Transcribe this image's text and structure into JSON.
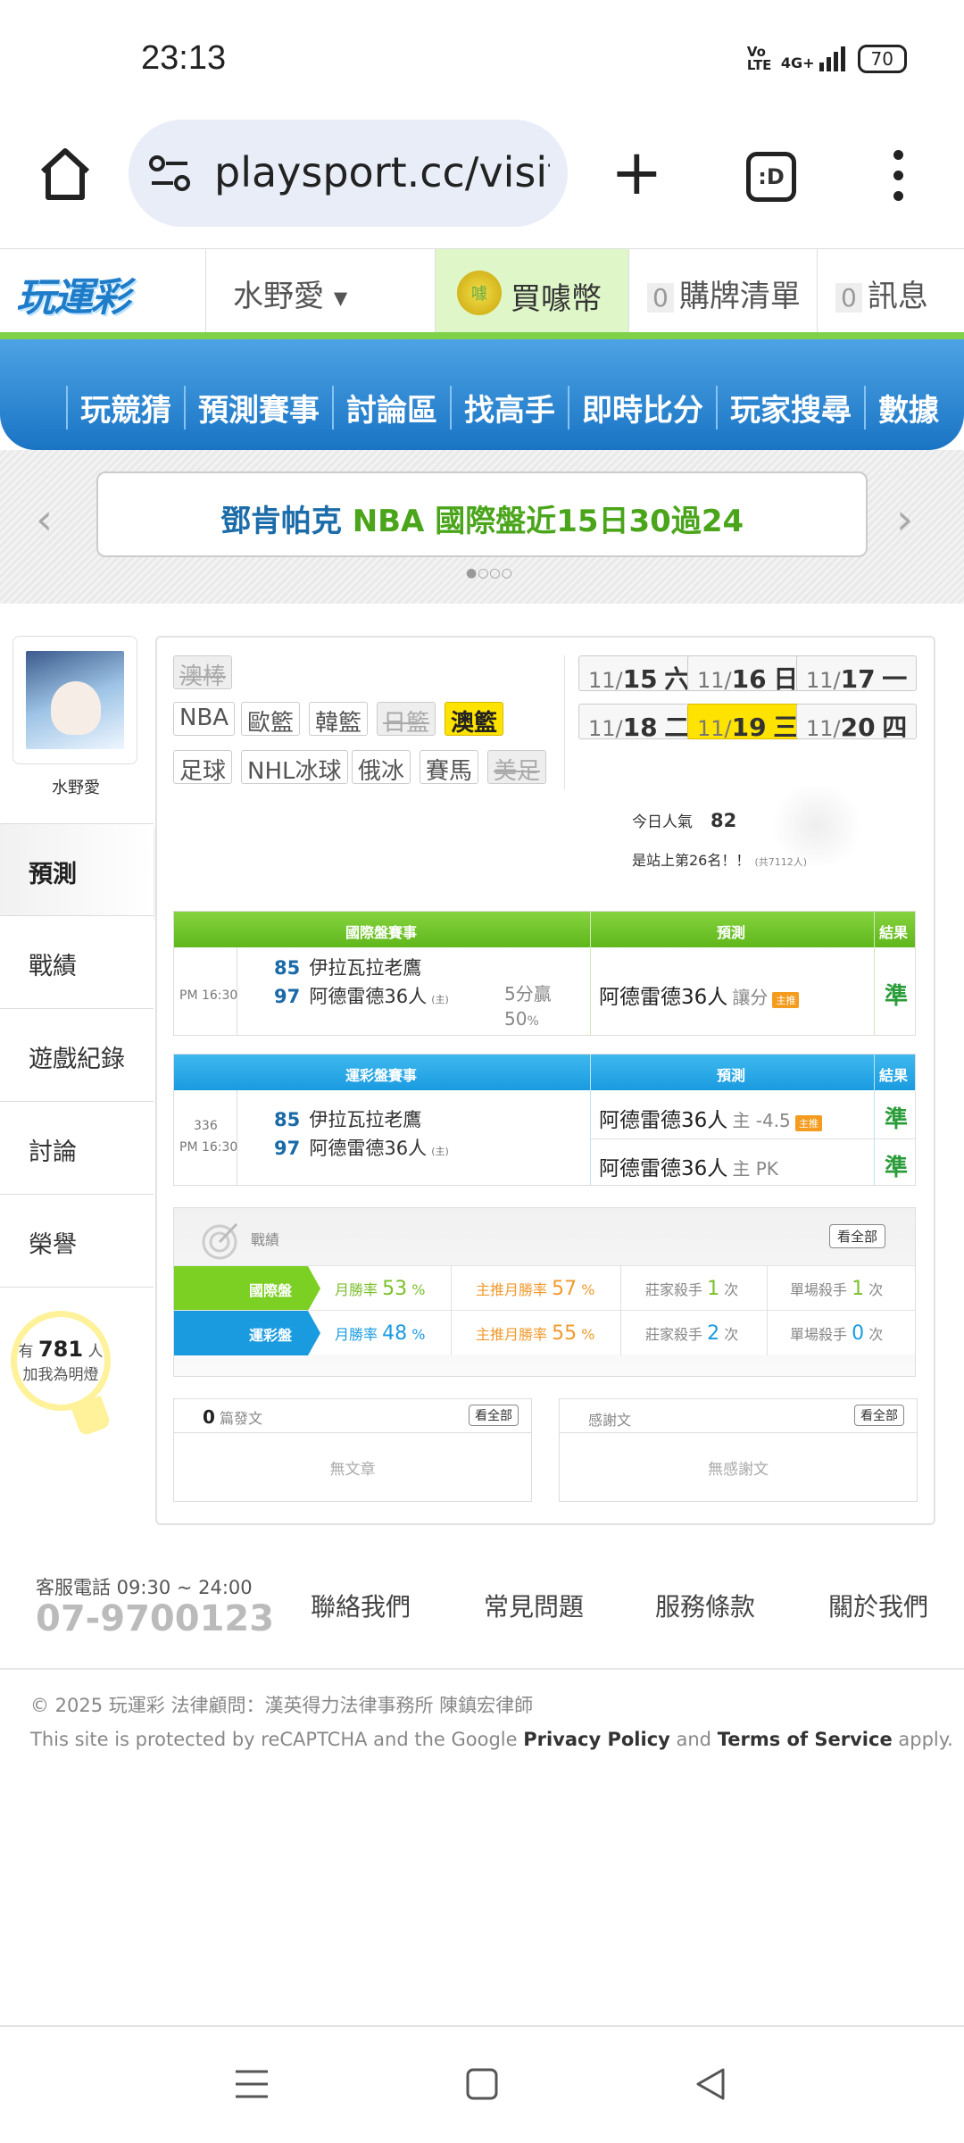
{
  "status_bar": {
    "time": "23:13",
    "volte": "Vo LTE",
    "signal": "4G+",
    "battery": "70"
  },
  "browser": {
    "url": "playsport.cc/visit",
    "tab_label": ":D"
  },
  "site_header": {
    "logo": "玩運彩",
    "user_menu": "水野愛",
    "buy_coin": "買噱幣",
    "coin_glyph": "噱",
    "cart_count": "0",
    "cart_label": "購牌清單",
    "msg_count": "0",
    "msg_label": "訊息"
  },
  "nav": [
    "玩競猜",
    "預測賽事",
    "討論區",
    "找高手",
    "即時比分",
    "玩家搜尋",
    "數據"
  ],
  "banner": {
    "part1": "鄧肯帕克 ",
    "part2": "NBA 國際盤近15日30過24",
    "prev": "‹",
    "next": "›",
    "dots": "●○○○"
  },
  "sidebar": {
    "username": "水野愛",
    "items": [
      "預測",
      "戰績",
      "遊戲紀錄",
      "討論",
      "榮譽"
    ],
    "fans_prefix": "有",
    "fans_count": "781",
    "fans_unit": "人",
    "fans_caption": "加我為明燈"
  },
  "sports_tags": {
    "row1": [
      "澳棒"
    ],
    "row2": [
      "NBA",
      "歐籃",
      "韓籃",
      "日籃",
      "澳籃"
    ],
    "row3": [
      "足球",
      "NHL冰球",
      "俄冰",
      "賽馬",
      "美足"
    ],
    "selected": "澳籃"
  },
  "dates": [
    {
      "md": "11/",
      "day": "15",
      "wk": "六"
    },
    {
      "md": "11/",
      "day": "16",
      "wk": "日"
    },
    {
      "md": "11/",
      "day": "17",
      "wk": "一"
    },
    {
      "md": "11/",
      "day": "18",
      "wk": "二"
    },
    {
      "md": "11/",
      "day": "19",
      "wk": "三"
    },
    {
      "md": "11/",
      "day": "20",
      "wk": "四"
    }
  ],
  "popularity": {
    "label": "今日人氣",
    "value": "82",
    "rank_text": "是站上第26名！！",
    "rank_total": "(共7112人)"
  },
  "intl_table": {
    "headers": [
      "國際盤賽事",
      "預測",
      "結果"
    ],
    "time": "PM 16:30",
    "away_score": "85",
    "away_team": "伊拉瓦拉老鷹",
    "home_score": "97",
    "home_team": "阿德雷德36人",
    "home_mark": "(主)",
    "margin": "5分贏",
    "pct": "50",
    "pct_sign": "%",
    "prediction": "阿德雷德36人",
    "pick": "讓分",
    "badge": "主推",
    "result": "準"
  },
  "lottery_table": {
    "headers": [
      "運彩盤賽事",
      "預測",
      "結果"
    ],
    "code": "336",
    "time": "PM 16:30",
    "away_score": "85",
    "away_team": "伊拉瓦拉老鷹",
    "home_score": "97",
    "home_team": "阿德雷德36人",
    "home_mark": "(主)",
    "pred1": "阿德雷德36人",
    "pred1_sub": "主 -4.5",
    "badge": "主推",
    "result1": "準",
    "pred2": "阿德雷德36人",
    "pred2_sub": "主 PK",
    "result2": "準"
  },
  "record": {
    "title": "戰績",
    "more": "看全部",
    "rows": [
      {
        "label": "國際盤",
        "monthly_label": "月勝率",
        "monthly": "53",
        "main_label": "主推月勝率",
        "main": "57",
        "pct": "%",
        "killer_label": "莊家殺手",
        "killer": "1",
        "single_label": "單場殺手",
        "single": "1",
        "unit": "次"
      },
      {
        "label": "運彩盤",
        "monthly_label": "月勝率",
        "monthly": "48",
        "main_label": "主推月勝率",
        "main": "55",
        "pct": "%",
        "killer_label": "莊家殺手",
        "killer": "2",
        "single_label": "單場殺手",
        "single": "0",
        "unit": "次"
      }
    ]
  },
  "articles": {
    "count": "0",
    "label": "篇發文",
    "more": "看全部",
    "empty": "無文章"
  },
  "thanks": {
    "label": "感謝文",
    "more": "看全部",
    "empty": "無感謝文"
  },
  "footer": {
    "service_label": "客服電話 09:30 ~ 24:00",
    "phone": "07-9700123",
    "links": [
      "聯絡我們",
      "常見問題",
      "服務條款",
      "關於我們"
    ],
    "copyright": "© 2025 玩運彩 法律顧問：漢英得力法律事務所 陳鎮宏律師",
    "recaptcha_pre": "This site is protected by reCAPTCHA and the Google ",
    "privacy": "Privacy Policy",
    "and": " and ",
    "terms": "Terms of Service",
    "apply": " apply."
  },
  "colors": {
    "nav_blue": "#1a74c4",
    "green": "#5fb71b",
    "lottery_blue": "#1a9be0",
    "selected_yellow": "#ffe300",
    "win_green": "#2a9c3a",
    "badge_orange": "#f39c1f"
  }
}
